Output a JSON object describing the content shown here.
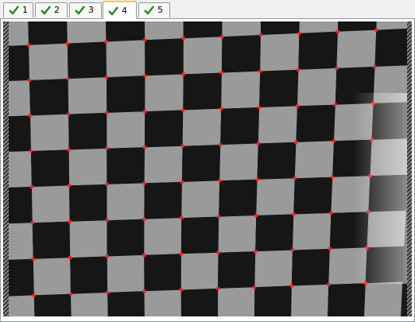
{
  "tabs": [
    {
      "label": "1",
      "icon": "checkmark-icon",
      "selected": false
    },
    {
      "label": "2",
      "icon": "checkmark-icon",
      "selected": false
    },
    {
      "label": "3",
      "icon": "checkmark-icon",
      "selected": false
    },
    {
      "label": "4",
      "icon": "checkmark-icon",
      "selected": true
    },
    {
      "label": "5",
      "icon": "checkmark-icon",
      "selected": false
    }
  ],
  "colors": {
    "check_green": "#1e8a1e",
    "tab_highlight": "#ffc83c",
    "square_light": "#9a9a9a",
    "square_dark": "#161616",
    "corner_marker": "#ff2020"
  },
  "image": {
    "content": "checkerboard-calibration-image",
    "detected_corner_markers": true
  }
}
